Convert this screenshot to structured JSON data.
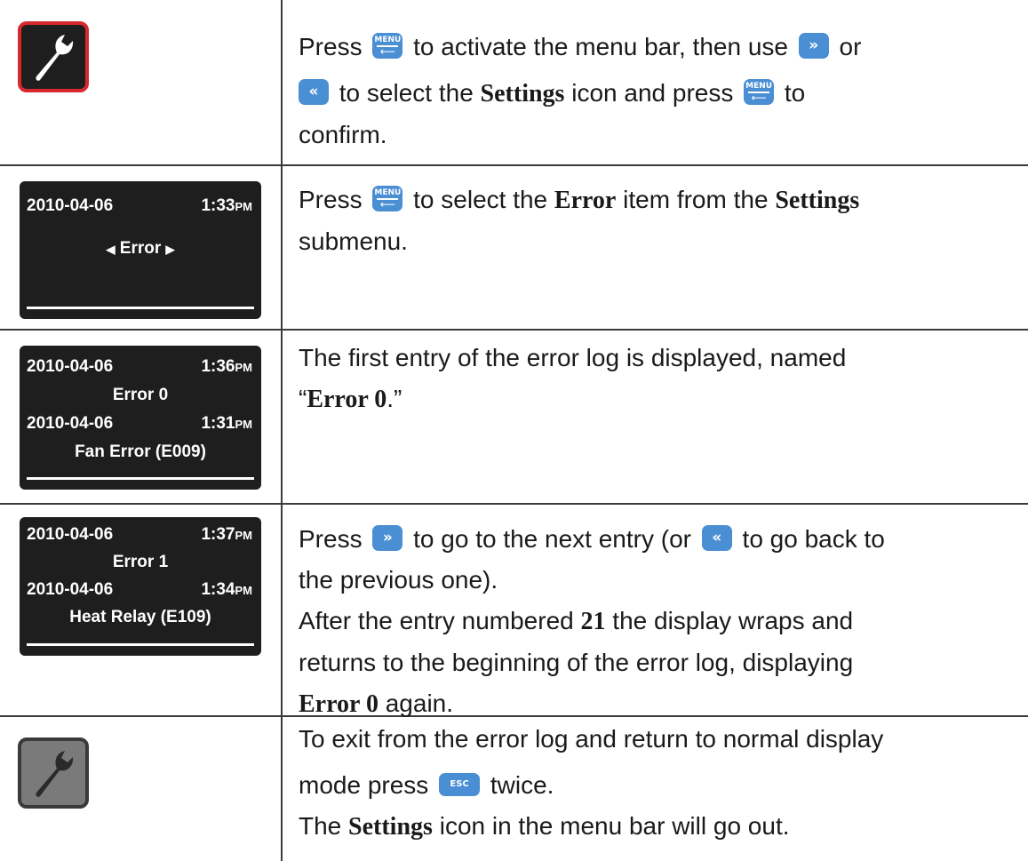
{
  "keys": {
    "menu": "MENU",
    "menu_arrow": "⟵",
    "right": "»",
    "left": "«",
    "esc": "ESC"
  },
  "rows": [
    {
      "icon": "wrench-red-icon",
      "text": {
        "t1": "Press",
        "t2": "to activate the menu bar, then use",
        "t3": "or",
        "t4": "to select the",
        "t5": "Settings",
        "t6": "icon and press",
        "t7": "to",
        "t8": "confirm."
      }
    },
    {
      "lcd": {
        "date": "2010-04-06",
        "time": "1:33",
        "ampm": "PM",
        "menu_item": "Error",
        "left_arrow": "◀",
        "right_arrow": "▶"
      },
      "text": {
        "t1": "Press",
        "t2": "to select the",
        "t3": "Error",
        "t4": "item from the",
        "t5": "Settings",
        "t6": "submenu."
      }
    },
    {
      "lcd": {
        "date": "2010-04-06",
        "time": "1:36",
        "ampm": "PM",
        "entry": "Error 0",
        "err_date": "2010-04-06",
        "err_time": "1:31",
        "err_ampm": "PM",
        "error": "Fan Error (E009)"
      },
      "text": {
        "t1": "The first entry of the error log is displayed, named",
        "q1": "“",
        "t2": "Error 0",
        "q2": ".”"
      }
    },
    {
      "lcd": {
        "date": "2010-04-06",
        "time": "1:37",
        "ampm": "PM",
        "entry": "Error 1",
        "err_date": "2010-04-06",
        "err_time": "1:34",
        "err_ampm": "PM",
        "error": "Heat Relay (E109)"
      },
      "text": {
        "t1": "Press",
        "t2": "to go to the next entry (or",
        "t3": "to go back to",
        "t4": "the previous one).",
        "t5": "After the entry numbered",
        "t6": "21",
        "t7": "the display wraps and",
        "t8": "returns to the beginning of the error log, displaying",
        "t9": "Error 0",
        "t10": "again."
      }
    },
    {
      "icon": "wrench-gray-icon",
      "text": {
        "t1": "To exit from the error log and return to normal display",
        "t2": "mode press",
        "t3": "twice.",
        "t4": "The",
        "t5": "Settings",
        "t6": "icon in the menu bar will go out."
      }
    }
  ],
  "colors": {
    "key_blue": "#4a8ed3",
    "lcd_bg": "#1e1e1e",
    "wrench_red_border": "#d9272e",
    "wrench_gray_bg": "#7a7a7a"
  }
}
